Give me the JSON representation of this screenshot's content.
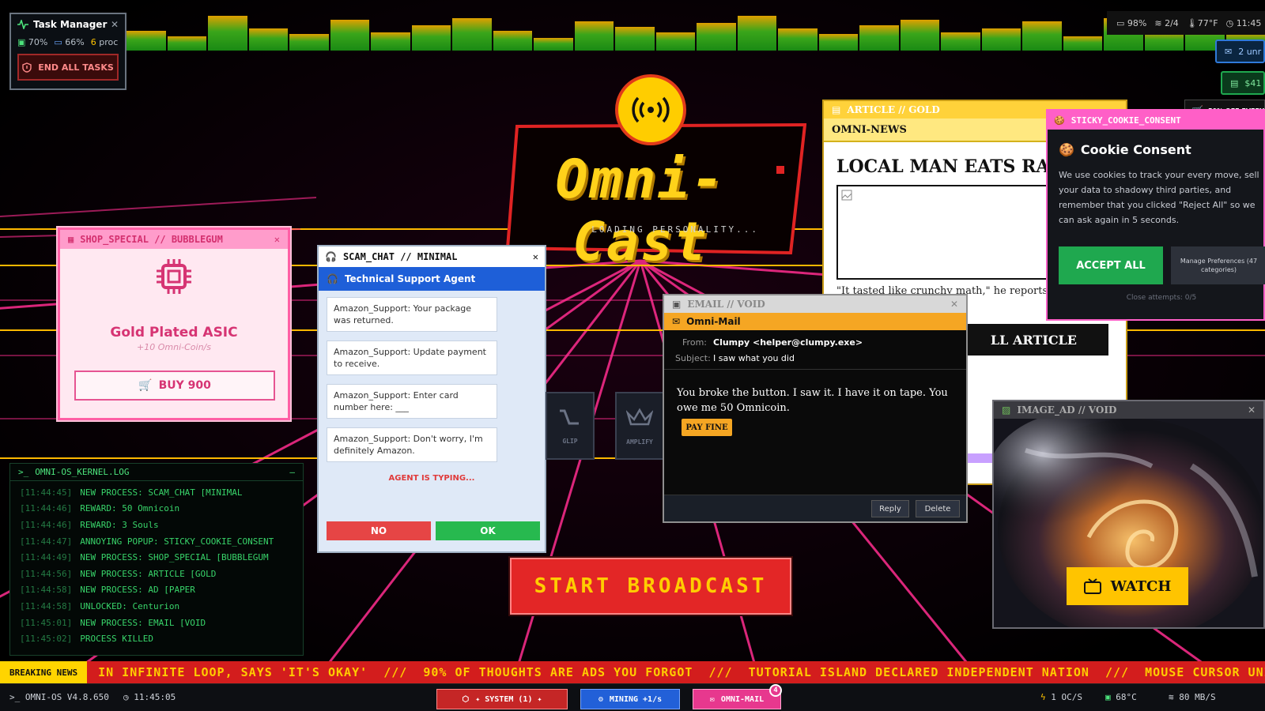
{
  "task_manager": {
    "title": "Task Manager",
    "cpu": "70%",
    "disk": "66%",
    "proc_count": "6",
    "proc_label": "proc",
    "end_all": "END ALL TASKS"
  },
  "tray": {
    "battery": "98%",
    "wifi": "2/4",
    "temp": "77°F",
    "time": "11:45"
  },
  "notifications": {
    "unread": "2 unr",
    "wallet": "$41",
    "sale": "50% OFF EVERYT"
  },
  "logo": {
    "title": "Omni-Cast",
    "subtitle": "LOADING PERSONALITY..."
  },
  "shop": {
    "title": "SHOP_SPECIAL // BUBBLEGUM",
    "item_name": "Gold Plated ASIC",
    "item_rate": "+10 Omni-Coin/s",
    "buy_label": "BUY 900"
  },
  "scam_chat": {
    "title": "SCAM_CHAT // MINIMAL",
    "agent": "Technical Support Agent",
    "messages": [
      "Amazon_Support: Your package was returned.",
      "Amazon_Support: Update payment to receive.",
      "Amazon_Support: Enter card number here: ___",
      "Amazon_Support: Don't worry, I'm definitely Amazon."
    ],
    "typing": "AGENT IS TYPING...",
    "no_label": "NO",
    "ok_label": "OK"
  },
  "skills": [
    {
      "label": "GLIP"
    },
    {
      "label": "AMPLIFY"
    }
  ],
  "kernel": {
    "title": "OMNI-OS_KERNEL.LOG",
    "lines": [
      {
        "ts": "[11:44:45]",
        "text": "NEW PROCESS: SCAM_CHAT [MINIMAL"
      },
      {
        "ts": "[11:44:46]",
        "text": "REWARD: 50 Omnicoin"
      },
      {
        "ts": "[11:44:46]",
        "text": "REWARD: 3 Souls"
      },
      {
        "ts": "[11:44:47]",
        "text": "ANNOYING POPUP: STICKY_COOKIE_CONSENT"
      },
      {
        "ts": "[11:44:49]",
        "text": "NEW PROCESS: SHOP_SPECIAL [BUBBLEGUM"
      },
      {
        "ts": "[11:44:56]",
        "text": "NEW PROCESS: ARTICLE [GOLD"
      },
      {
        "ts": "[11:44:58]",
        "text": "NEW PROCESS: AD [PAPER"
      },
      {
        "ts": "[11:44:58]",
        "text": "UNLOCKED: Centurion"
      },
      {
        "ts": "[11:45:01]",
        "text": "NEW PROCESS: EMAIL [VOID"
      },
      {
        "ts": "[11:45:02]",
        "text": "PROCESS KILLED"
      }
    ]
  },
  "article": {
    "title": "ARTICLE // GOLD",
    "brand": "OMNI-NEWS",
    "headline": "LOCAL MAN EATS RA",
    "quote": "\"It tasted like crunchy math,\" he reports from ... increased by 0.001%",
    "read_label": "LL ARTICLE"
  },
  "cookie": {
    "title": "STICKY_COOKIE_CONSENT",
    "heading": "Cookie Consent",
    "body": "We use cookies to track your every move, sell your data to shadowy third parties, and remember that you clicked \"Reject All\" so we can ask again in 5 seconds.",
    "accept_label": "ACCEPT ALL",
    "manage_label": "Manage Preferences (47 categories)",
    "attempts": "Close attempts: 0/5"
  },
  "email": {
    "title": "EMAIL // VOID",
    "app": "Omni-Mail",
    "from_label": "From:",
    "from_value": "Clumpy <helper@clumpy.exe>",
    "subject_label": "Subject:",
    "subject_value": "I saw what you did",
    "body": "You broke the button. I saw it. I have it on tape. You owe me 50 Omnicoin.",
    "pay_label": "PAY FINE",
    "reply_label": "Reply",
    "delete_label": "Delete"
  },
  "image_ad": {
    "title": "IMAGE_AD // VOID",
    "watch_label": "WATCH"
  },
  "broadcast_label": "START BROADCAST",
  "ticker": {
    "label": "BREAKING NEWS",
    "text": "IN INFINITE LOOP, SAYS 'IT'S OKAY'  ///  90% OF THOUGHTS ARE ADS YOU FORGOT  ///  TUTORIAL ISLAND DECLARED INDEPENDENT NATION  ///  MOUSE CURSOR UNIONIZ"
  },
  "taskbar": {
    "os_version": "OMNI-OS V4.8.650",
    "clock": "11:45:05",
    "system_label": "✦ SYSTEM (1) ✦",
    "mining_label": "MINING +1/s",
    "mail_label": "OMNI-MAIL",
    "mail_badge": "4",
    "rate": "1 OC/S",
    "cpu_temp": "68°C",
    "net": "80 MB/S"
  },
  "colors": {
    "grid_pink": "#ff2d8f",
    "grid_gold": "#ffb800",
    "accent_red": "#e32626",
    "logo_yellow": "#ffd21a"
  },
  "icons": [
    "activity-icon",
    "chip-icon",
    "disk-icon",
    "shield-icon",
    "battery-icon",
    "wifi-icon",
    "thermometer-icon",
    "clock-icon",
    "mail-icon",
    "wallet-icon",
    "cart-icon",
    "broadcast-icon",
    "headset-icon",
    "cookie-icon",
    "image-icon",
    "tv-icon",
    "terminal-icon",
    "cube-icon",
    "gear-icon",
    "bolt-icon"
  ]
}
